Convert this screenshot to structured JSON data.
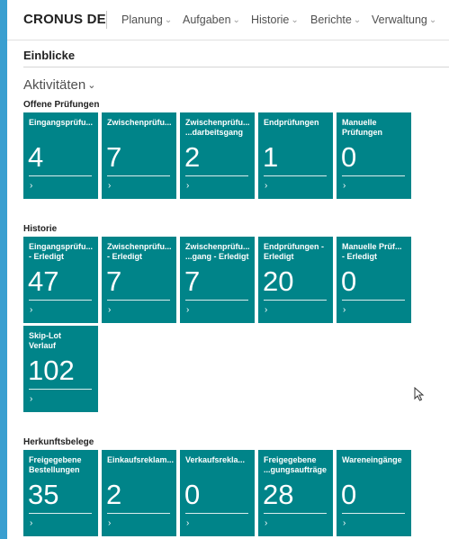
{
  "app": {
    "company": "CRONUS DE",
    "nav": [
      "Planung",
      "Aufgaben",
      "Historie",
      "Berichte",
      "Verwaltung"
    ]
  },
  "page": {
    "title": "Einblicke",
    "section": "Aktivitäten"
  },
  "groups": [
    {
      "label": "Offene Prüfungen",
      "tiles": [
        {
          "label": "Eingangsprüfu...",
          "value": "4"
        },
        {
          "label": "Zwischenprüfu...",
          "value": "7"
        },
        {
          "label": "Zwischenprüfu...\n...darbeitsgang",
          "value": "2"
        },
        {
          "label": "Endprüfungen",
          "value": "1"
        },
        {
          "label": "Manuelle\nPrüfungen",
          "value": "0"
        }
      ]
    },
    {
      "label": "Historie",
      "tiles": [
        {
          "label": "Eingangsprüfu...\n- Erledigt",
          "value": "47"
        },
        {
          "label": "Zwischenprüfu...\n- Erledigt",
          "value": "7"
        },
        {
          "label": "Zwischenprüfu...\n...gang - Erledigt",
          "value": "7"
        },
        {
          "label": "Endprüfungen -\nErledigt",
          "value": "20"
        },
        {
          "label": "Manuelle Prüf...\n- Erledigt",
          "value": "0"
        },
        {
          "label": "Skip-Lot\nVerlauf",
          "value": "102"
        }
      ]
    },
    {
      "label": "Herkunftsbelege",
      "tiles": [
        {
          "label": "Freigegebene\nBestellungen",
          "value": "35"
        },
        {
          "label": "Einkaufsreklam...",
          "value": "2"
        },
        {
          "label": "Verkaufsrekla...",
          "value": "0"
        },
        {
          "label": "Freigegebene\n...gungsaufträge",
          "value": "28"
        },
        {
          "label": "Wareneingänge",
          "value": "0"
        }
      ]
    }
  ],
  "tile_arrow": "›",
  "colors": {
    "tile": "#008489",
    "frame_accent": "#3a9fd0"
  }
}
